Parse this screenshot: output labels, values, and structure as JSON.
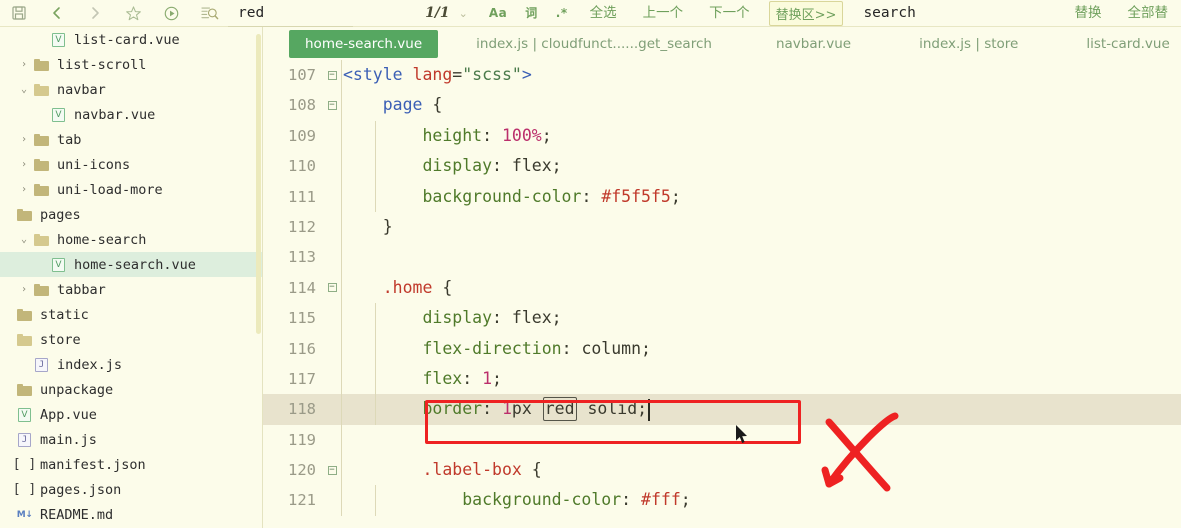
{
  "toolbar": {
    "icons": [
      {
        "name": "save-icon",
        "title": "保存"
      },
      {
        "name": "back-arrow-icon",
        "title": "后退"
      },
      {
        "name": "forward-arrow-icon",
        "title": "前进"
      },
      {
        "name": "star-icon",
        "title": "收藏"
      },
      {
        "name": "run-icon",
        "title": "运行"
      },
      {
        "name": "find-in-files-icon",
        "title": "查找"
      }
    ],
    "search_value": "red",
    "search_placeholder": "查找",
    "match_count": "1/1",
    "caret_glyph": "⌄",
    "case_label": "Aa",
    "word_label": "词",
    "regex_label": ".*",
    "select_all_label": "全选",
    "prev_label": "上一个",
    "next_label": "下一个",
    "replace_area_label": "替换区>>",
    "replace_value": "search",
    "replace_placeholder": "替换",
    "replace_label": "替换",
    "replace_all_label": "全部替"
  },
  "sidebar": {
    "items": [
      {
        "label": "list-card.vue",
        "icon": "vue-file-icon",
        "indent": 2,
        "arrow": "",
        "selected": false
      },
      {
        "label": "list-scroll",
        "icon": "folder-icon",
        "indent": 1,
        "arrow": "›",
        "selected": false
      },
      {
        "label": "navbar",
        "icon": "folder-open-icon",
        "indent": 1,
        "arrow": "⌄",
        "selected": false
      },
      {
        "label": "navbar.vue",
        "icon": "vue-file-icon",
        "indent": 2,
        "arrow": "",
        "selected": false
      },
      {
        "label": "tab",
        "icon": "folder-icon",
        "indent": 1,
        "arrow": "›",
        "selected": false
      },
      {
        "label": "uni-icons",
        "icon": "folder-icon",
        "indent": 1,
        "arrow": "›",
        "selected": false
      },
      {
        "label": "uni-load-more",
        "icon": "folder-icon",
        "indent": 1,
        "arrow": "›",
        "selected": false
      },
      {
        "label": "pages",
        "icon": "folder-icon",
        "indent": 0,
        "arrow": "",
        "selected": false
      },
      {
        "label": "home-search",
        "icon": "folder-open-icon",
        "indent": 1,
        "arrow": "⌄",
        "selected": false
      },
      {
        "label": "home-search.vue",
        "icon": "vue-file-icon",
        "indent": 2,
        "arrow": "",
        "selected": true
      },
      {
        "label": "tabbar",
        "icon": "folder-icon",
        "indent": 1,
        "arrow": "›",
        "selected": false
      },
      {
        "label": "static",
        "icon": "folder-icon",
        "indent": 0,
        "arrow": "",
        "selected": false
      },
      {
        "label": "store",
        "icon": "folder-open-icon",
        "indent": 0,
        "arrow": "",
        "selected": false
      },
      {
        "label": "index.js",
        "icon": "js-file-icon",
        "indent": 1,
        "arrow": "",
        "selected": false
      },
      {
        "label": "unpackage",
        "icon": "folder-icon",
        "indent": 0,
        "arrow": "",
        "selected": false
      },
      {
        "label": "App.vue",
        "icon": "vue-file-icon",
        "indent": 0,
        "arrow": "",
        "selected": false
      },
      {
        "label": "main.js",
        "icon": "js-file-icon",
        "indent": 0,
        "arrow": "",
        "selected": false
      },
      {
        "label": "manifest.json",
        "icon": "json-file-icon",
        "indent": 0,
        "arrow": "",
        "selected": false
      },
      {
        "label": "pages.json",
        "icon": "json-file-icon",
        "indent": 0,
        "arrow": "",
        "selected": false
      },
      {
        "label": "README.md",
        "icon": "md-file-icon",
        "indent": 0,
        "arrow": "",
        "selected": false
      }
    ]
  },
  "editor": {
    "tabs": [
      {
        "label": "home-search.vue",
        "active": true
      },
      {
        "label": "index.js | cloudfunct......get_search",
        "active": false
      },
      {
        "label": "navbar.vue",
        "active": false
      },
      {
        "label": "index.js | store",
        "active": false
      },
      {
        "label": "list-card.vue",
        "active": false
      }
    ],
    "lines": [
      {
        "num": "107",
        "fold": "-",
        "guide": false,
        "highlight": false,
        "tokens": [
          {
            "t": "<style ",
            "c": "t-tag"
          },
          {
            "t": "lang",
            "c": "t-attr"
          },
          {
            "t": "=",
            "c": "t-plain"
          },
          {
            "t": "\"scss\"",
            "c": "t-str"
          },
          {
            "t": ">",
            "c": "t-tag"
          }
        ]
      },
      {
        "num": "108",
        "fold": "-",
        "guide": false,
        "highlight": false,
        "tokens": [
          {
            "t": "    ",
            "c": "t-plain"
          },
          {
            "t": "page",
            "c": "t-tag"
          },
          {
            "t": " {",
            "c": "t-plain"
          }
        ]
      },
      {
        "num": "109",
        "fold": "",
        "guide": true,
        "highlight": false,
        "tokens": [
          {
            "t": "        ",
            "c": "t-plain"
          },
          {
            "t": "height",
            "c": "t-prop"
          },
          {
            "t": ": ",
            "c": "t-plain"
          },
          {
            "t": "100%",
            "c": "t-num"
          },
          {
            "t": ";",
            "c": "t-plain"
          }
        ]
      },
      {
        "num": "110",
        "fold": "",
        "guide": true,
        "highlight": false,
        "tokens": [
          {
            "t": "        ",
            "c": "t-plain"
          },
          {
            "t": "display",
            "c": "t-prop"
          },
          {
            "t": ": ",
            "c": "t-plain"
          },
          {
            "t": "flex",
            "c": "t-val"
          },
          {
            "t": ";",
            "c": "t-plain"
          }
        ]
      },
      {
        "num": "111",
        "fold": "",
        "guide": true,
        "highlight": false,
        "tokens": [
          {
            "t": "        ",
            "c": "t-plain"
          },
          {
            "t": "background-color",
            "c": "t-prop"
          },
          {
            "t": ": ",
            "c": "t-plain"
          },
          {
            "t": "#f5f5f5",
            "c": "t-hex"
          },
          {
            "t": ";",
            "c": "t-plain"
          }
        ]
      },
      {
        "num": "112",
        "fold": "",
        "guide": false,
        "highlight": false,
        "tokens": [
          {
            "t": "    }",
            "c": "t-plain"
          }
        ]
      },
      {
        "num": "113",
        "fold": "",
        "guide": false,
        "highlight": false,
        "tokens": [
          {
            "t": "",
            "c": "t-plain"
          }
        ]
      },
      {
        "num": "114",
        "fold": "-",
        "guide": false,
        "highlight": false,
        "tokens": [
          {
            "t": "    ",
            "c": "t-plain"
          },
          {
            "t": ".home",
            "c": "t-sel"
          },
          {
            "t": " {",
            "c": "t-plain"
          }
        ]
      },
      {
        "num": "115",
        "fold": "",
        "guide": true,
        "highlight": false,
        "tokens": [
          {
            "t": "        ",
            "c": "t-plain"
          },
          {
            "t": "display",
            "c": "t-prop"
          },
          {
            "t": ": ",
            "c": "t-plain"
          },
          {
            "t": "flex",
            "c": "t-val"
          },
          {
            "t": ";",
            "c": "t-plain"
          }
        ]
      },
      {
        "num": "116",
        "fold": "",
        "guide": true,
        "highlight": false,
        "tokens": [
          {
            "t": "        ",
            "c": "t-plain"
          },
          {
            "t": "flex-direction",
            "c": "t-prop"
          },
          {
            "t": ": ",
            "c": "t-plain"
          },
          {
            "t": "column",
            "c": "t-val"
          },
          {
            "t": ";",
            "c": "t-plain"
          }
        ]
      },
      {
        "num": "117",
        "fold": "",
        "guide": true,
        "highlight": false,
        "tokens": [
          {
            "t": "        ",
            "c": "t-plain"
          },
          {
            "t": "flex",
            "c": "t-prop"
          },
          {
            "t": ": ",
            "c": "t-plain"
          },
          {
            "t": "1",
            "c": "t-num"
          },
          {
            "t": ";",
            "c": "t-plain"
          }
        ]
      },
      {
        "num": "118",
        "fold": "",
        "guide": true,
        "highlight": true,
        "tokens": [
          {
            "t": "        ",
            "c": "t-plain"
          },
          {
            "t": "border",
            "c": "t-prop"
          },
          {
            "t": ": ",
            "c": "t-plain"
          },
          {
            "t": "1",
            "c": "t-num"
          },
          {
            "t": "px ",
            "c": "t-val"
          },
          {
            "t": "red",
            "c": "t-val",
            "box": true
          },
          {
            "t": " solid;",
            "c": "t-val"
          }
        ],
        "caret": true
      },
      {
        "num": "119",
        "fold": "",
        "guide": false,
        "highlight": false,
        "tokens": [
          {
            "t": "",
            "c": "t-plain"
          }
        ]
      },
      {
        "num": "120",
        "fold": "-",
        "guide": false,
        "highlight": false,
        "tokens": [
          {
            "t": "        ",
            "c": "t-plain"
          },
          {
            "t": ".label-box",
            "c": "t-sel"
          },
          {
            "t": " {",
            "c": "t-plain"
          }
        ]
      },
      {
        "num": "121",
        "fold": "",
        "guide": true,
        "highlight": false,
        "tokens": [
          {
            "t": "            ",
            "c": "t-plain"
          },
          {
            "t": "background-color",
            "c": "t-prop"
          },
          {
            "t": ": ",
            "c": "t-plain"
          },
          {
            "t": "#fff",
            "c": "t-hex"
          },
          {
            "t": ";",
            "c": "t-plain"
          }
        ]
      }
    ]
  },
  "annotations": {
    "rect_color": "#ee2222",
    "x_mark_color": "#ee2222",
    "rect_name": "red-highlight-rectangle",
    "x_name": "red-x-mark"
  }
}
